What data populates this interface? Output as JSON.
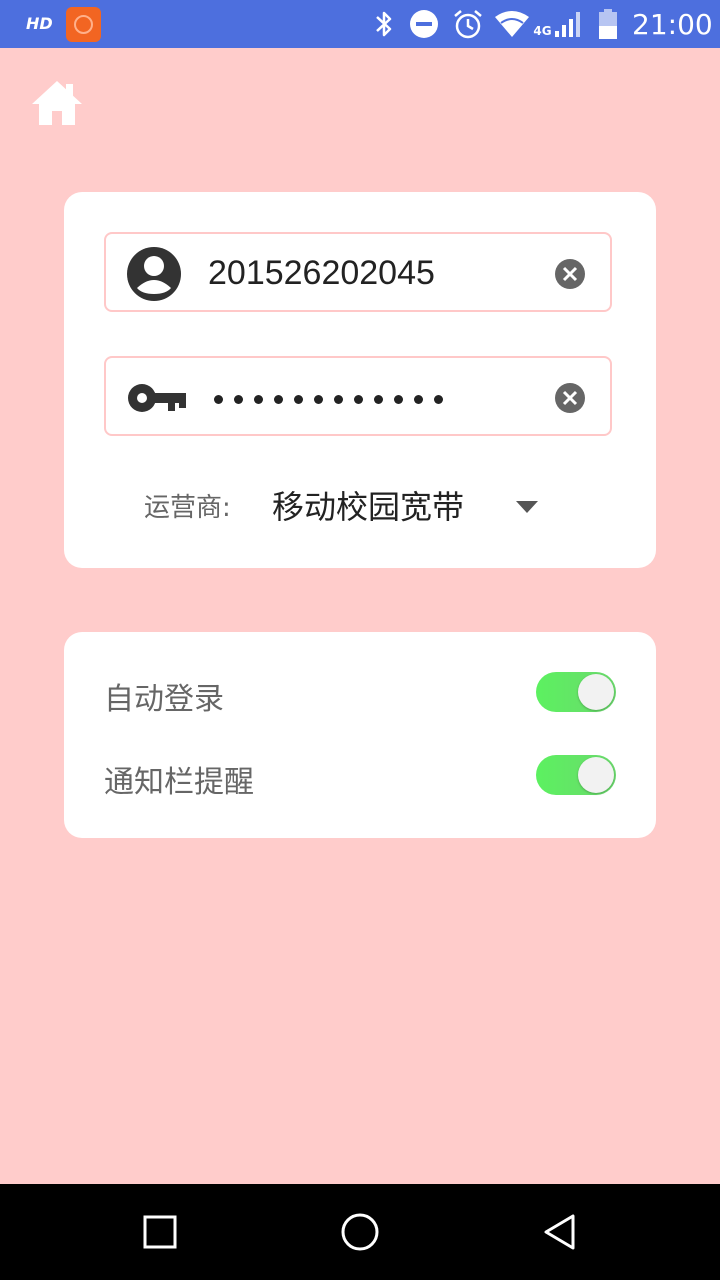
{
  "status_bar": {
    "hd_label": "HD",
    "time": "21:00",
    "network_label": "4G",
    "icons": [
      "app-icon",
      "bluetooth-icon",
      "do-not-disturb-icon",
      "alarm-icon",
      "wifi-icon",
      "signal-icon",
      "battery-icon"
    ]
  },
  "header": {
    "home_icon": "home-icon"
  },
  "login": {
    "username": "201526202045",
    "password_mask_count": 12,
    "user_icon": "user-avatar-icon",
    "key_icon": "key-icon",
    "clear_icon": "clear-icon",
    "carrier_label": "运营商:",
    "carrier_value": "移动校园宽带",
    "dropdown_icon": "dropdown-arrow-icon"
  },
  "settings": {
    "auto_login": {
      "label": "自动登录",
      "on": true
    },
    "notification": {
      "label": "通知栏提醒",
      "on": true
    },
    "accent_color": "#5cf160"
  },
  "nav_bar": {
    "icons": [
      "recent-apps-icon",
      "home-circle-icon",
      "back-icon"
    ]
  },
  "colors": {
    "background": "#ffcccb",
    "status_bar": "#4d6fde",
    "field_border": "#ffc8c8"
  }
}
